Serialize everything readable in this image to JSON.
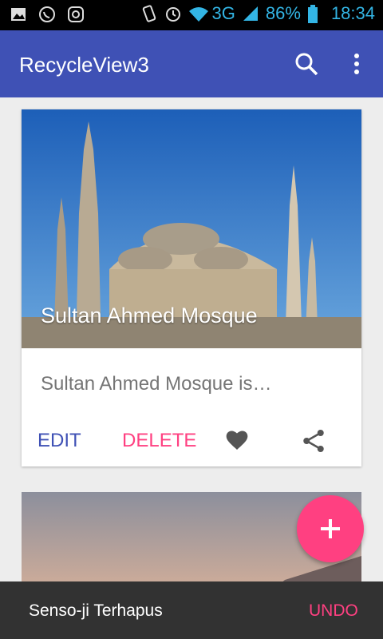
{
  "status_bar": {
    "network": "3G",
    "battery": "86%",
    "time": "18:34"
  },
  "toolbar": {
    "title": "RecycleView3",
    "icons": [
      "search-icon",
      "more-vert-icon"
    ]
  },
  "cards": [
    {
      "title": "Sultan Ahmed Mosque",
      "description": "Sultan Ahmed Mosque is…",
      "edit_label": "EDIT",
      "delete_label": "DELETE",
      "icons": [
        "heart-icon",
        "share-icon"
      ]
    }
  ],
  "snackbar": {
    "message": "Senso-ji Terhapus",
    "action": "UNDO"
  },
  "colors": {
    "primary": "#3f51b5",
    "accent": "#ff4081",
    "snackbar": "#323232"
  }
}
